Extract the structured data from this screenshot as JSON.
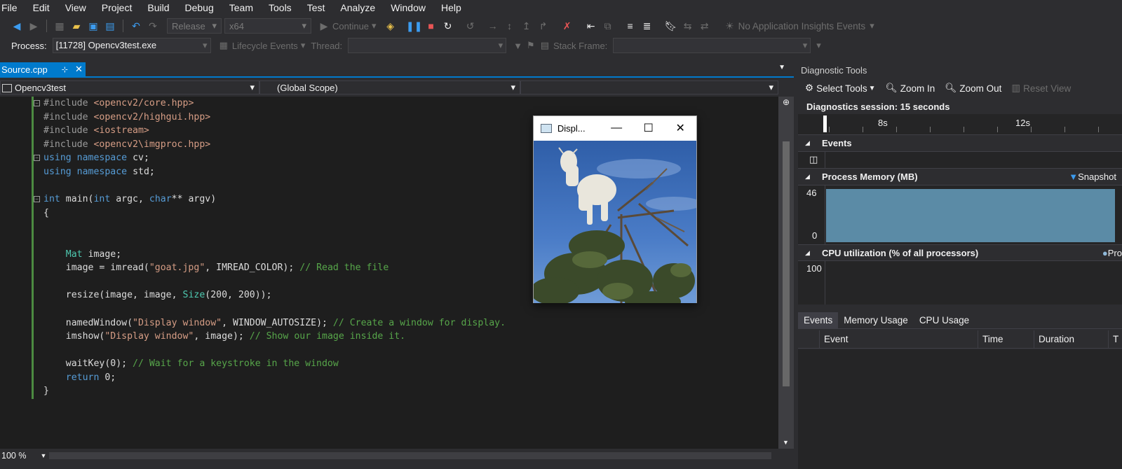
{
  "menu": [
    "File",
    "Edit",
    "View",
    "Project",
    "Build",
    "Debug",
    "Team",
    "Tools",
    "Test",
    "Analyze",
    "Window",
    "Help"
  ],
  "toolbar": {
    "config": "Release",
    "platform": "x64",
    "continue": "Continue",
    "insights": "No Application Insights Events"
  },
  "procbar": {
    "process_label": "Process:",
    "process_value": "[11728] Opencv3test.exe",
    "lifecycle": "Lifecycle Events",
    "thread_label": "Thread:",
    "stackframe_label": "Stack Frame:"
  },
  "editor": {
    "tab_title": "Source.cpp",
    "project": "Opencv3test",
    "scope": "(Global Scope)",
    "zoom": "100 %"
  },
  "code_lines": [
    [
      {
        "t": "#include ",
        "c": "inc"
      },
      {
        "t": "<opencv2/core.hpp>",
        "c": "str"
      }
    ],
    [
      {
        "t": "#include ",
        "c": "inc"
      },
      {
        "t": "<opencv2/highgui.hpp>",
        "c": "str"
      }
    ],
    [
      {
        "t": "#include ",
        "c": "inc"
      },
      {
        "t": "<iostream>",
        "c": "str"
      }
    ],
    [
      {
        "t": "#include ",
        "c": "inc"
      },
      {
        "t": "<opencv2\\imgproc.hpp>",
        "c": "str"
      }
    ],
    [
      {
        "t": "using",
        "c": "kw"
      },
      {
        "t": " ",
        "c": ""
      },
      {
        "t": "namespace",
        "c": "kw"
      },
      {
        "t": " cv;",
        "c": ""
      }
    ],
    [
      {
        "t": "using",
        "c": "kw"
      },
      {
        "t": " ",
        "c": ""
      },
      {
        "t": "namespace",
        "c": "kw"
      },
      {
        "t": " std;",
        "c": ""
      }
    ],
    [],
    [
      {
        "t": "int",
        "c": "kw"
      },
      {
        "t": " main(",
        "c": ""
      },
      {
        "t": "int",
        "c": "kw"
      },
      {
        "t": " argc, ",
        "c": ""
      },
      {
        "t": "char",
        "c": "kw"
      },
      {
        "t": "** argv)",
        "c": ""
      }
    ],
    [
      {
        "t": "{",
        "c": ""
      }
    ],
    [],
    [],
    [
      {
        "t": "    ",
        "c": ""
      },
      {
        "t": "Mat",
        "c": "typ"
      },
      {
        "t": " image;",
        "c": ""
      }
    ],
    [
      {
        "t": "    image = imread(",
        "c": ""
      },
      {
        "t": "\"goat.jpg\"",
        "c": "str"
      },
      {
        "t": ", IMREAD_COLOR); ",
        "c": ""
      },
      {
        "t": "// Read the file",
        "c": "cmt"
      }
    ],
    [],
    [
      {
        "t": "    resize(image, image, ",
        "c": ""
      },
      {
        "t": "Size",
        "c": "typ"
      },
      {
        "t": "(200, 200));",
        "c": ""
      }
    ],
    [],
    [
      {
        "t": "    namedWindow(",
        "c": ""
      },
      {
        "t": "\"Display window\"",
        "c": "str"
      },
      {
        "t": ", WINDOW_AUTOSIZE); ",
        "c": ""
      },
      {
        "t": "// Create a window for display.",
        "c": "cmt"
      }
    ],
    [
      {
        "t": "    imshow(",
        "c": ""
      },
      {
        "t": "\"Display window\"",
        "c": "str"
      },
      {
        "t": ", image); ",
        "c": ""
      },
      {
        "t": "// Show our image inside it.",
        "c": "cmt"
      }
    ],
    [],
    [
      {
        "t": "    waitKey(0); ",
        "c": ""
      },
      {
        "t": "// Wait for a keystroke in the window",
        "c": "cmt"
      }
    ],
    [
      {
        "t": "    ",
        "c": ""
      },
      {
        "t": "return",
        "c": "kw"
      },
      {
        "t": " 0;",
        "c": ""
      }
    ],
    [
      {
        "t": "}",
        "c": ""
      }
    ]
  ],
  "display_window": {
    "title": "Displ..."
  },
  "diag": {
    "title": "Diagnostic Tools",
    "select_tools": "Select Tools",
    "zoom_in": "Zoom In",
    "zoom_out": "Zoom Out",
    "reset_view": "Reset View",
    "session": "Diagnostics session: 15 seconds",
    "tick_8": "8s",
    "tick_12": "12s",
    "events": "Events",
    "memory_title": "Process Memory (MB)",
    "snapshot": "Snapshot",
    "mem_max": "46",
    "mem_min": "0",
    "cpu_title": "CPU utilization (% of all processors)",
    "cpu_legend": "Pro",
    "cpu_max": "100",
    "memory_level_fraction": 1.0,
    "tabs": [
      "Events",
      "Memory Usage",
      "CPU Usage"
    ],
    "columns": [
      "Event",
      "Time",
      "Duration",
      "T"
    ]
  }
}
